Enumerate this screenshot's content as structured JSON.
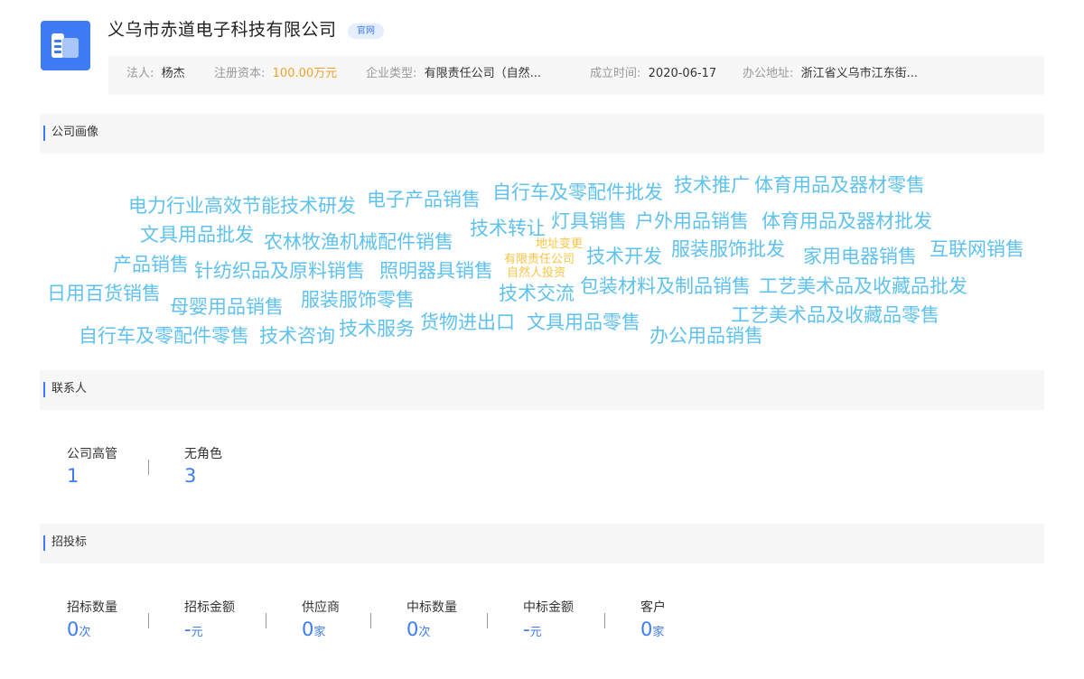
{
  "company": {
    "name": "义乌市赤道电子科技有限公司",
    "official_tag": "官网",
    "info": [
      {
        "key": "法人:",
        "value": "杨杰"
      },
      {
        "key": "注册资本:",
        "value": "100.00万元"
      },
      {
        "key": "企业类型:",
        "value": "有限责任公司（自然..."
      },
      {
        "key": "成立时间:",
        "value": "2020-06-17"
      },
      {
        "key": "办公地址:",
        "value": "浙江省义乌市江东街..."
      }
    ]
  },
  "colors": {
    "accent": "#3d7cf2",
    "cloud_primary": "#5ec1ee",
    "cloud_secondary": "#f7c444",
    "capital": "#f0a12c"
  },
  "sections": {
    "portrait": {
      "title": "公司画像"
    },
    "contacts": {
      "title": "联系人"
    },
    "bidding": {
      "title": "招投标"
    }
  },
  "word_cloud": [
    "电力行业高效节能技术研发",
    "电子产品销售",
    "自行车及零配件批发",
    "技术推广",
    "体育用品及器材零售",
    "文具用品批发",
    "技术转让",
    "灯具销售",
    "户外用品销售",
    "体育用品及器材批发",
    "农林牧渔机械配件销售",
    "地址变更",
    "技术开发",
    "服装服饰批发",
    "家用电器销售",
    "互联网销售",
    "产品销售",
    "有限责任公司",
    "针纺织品及原料销售",
    "照明器具销售",
    "自然人投资",
    "技术交流",
    "包装材料及制品销售",
    "工艺美术品及收藏品批发",
    "日用百货销售",
    "母婴用品销售",
    "服装服饰零售",
    "工艺美术品及收藏品零售",
    "技术服务",
    "货物进出口",
    "文具用品零售",
    "自行车及零配件零售",
    "技术咨询",
    "办公用品销售"
  ],
  "contacts_stats": [
    {
      "label": "公司高管",
      "value": "1"
    },
    {
      "label": "无角色",
      "value": "3"
    }
  ],
  "bidding_stats": [
    {
      "label": "招标数量",
      "value": "0",
      "unit": "次"
    },
    {
      "label": "招标金额",
      "value": "-",
      "unit": "元"
    },
    {
      "label": "供应商",
      "value": "0",
      "unit": "家"
    },
    {
      "label": "中标数量",
      "value": "0",
      "unit": "次"
    },
    {
      "label": "中标金额",
      "value": "-",
      "unit": "元"
    },
    {
      "label": "客户",
      "value": "0",
      "unit": "家"
    }
  ]
}
